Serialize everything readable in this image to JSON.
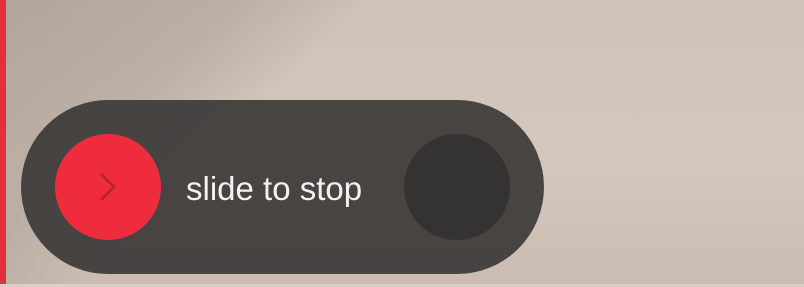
{
  "slider": {
    "label": "slide to stop",
    "knob_icon": "chevron-right-icon",
    "colors": {
      "track": "#3f3c3a",
      "knob": "#ef2c3e",
      "target": "#353331",
      "label": "#f2f2f2",
      "accent_edge": "#e0313f"
    }
  }
}
